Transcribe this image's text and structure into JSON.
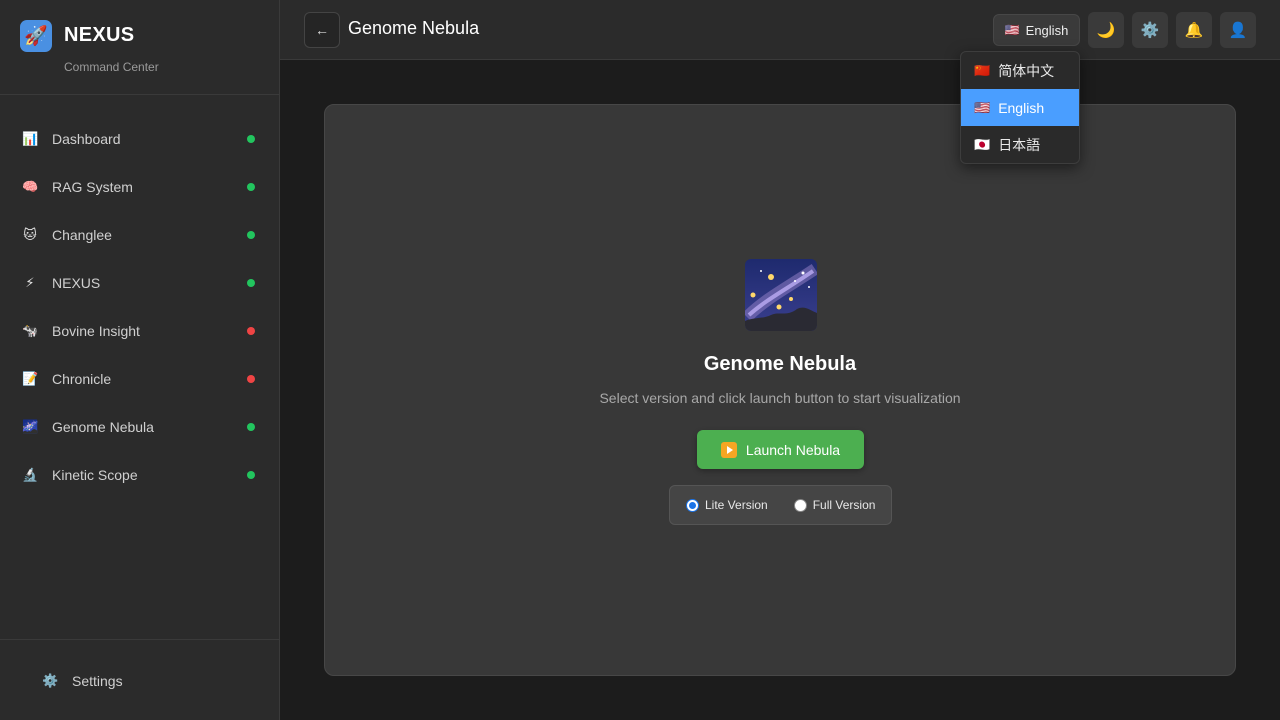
{
  "brand": {
    "name": "NEXUS",
    "subtitle": "Command Center",
    "logo_icon": "rocket-icon"
  },
  "sidebar": {
    "items": [
      {
        "label": "Dashboard",
        "icon": "bar-chart-icon",
        "glyph": "📊",
        "status": "online",
        "status_color": "#22c55e"
      },
      {
        "label": "RAG System",
        "icon": "brain-icon",
        "glyph": "🧠",
        "status": "online",
        "status_color": "#22c55e"
      },
      {
        "label": "Changlee",
        "icon": "cat-icon",
        "glyph": "🐱",
        "status": "online",
        "status_color": "#22c55e"
      },
      {
        "label": "NEXUS",
        "icon": "lightning-icon",
        "glyph": "⚡",
        "status": "online",
        "status_color": "#22c55e"
      },
      {
        "label": "Bovine Insight",
        "icon": "cow-icon",
        "glyph": "🐄",
        "status": "offline",
        "status_color": "#ef4444"
      },
      {
        "label": "Chronicle",
        "icon": "memo-icon",
        "glyph": "📝",
        "status": "offline",
        "status_color": "#ef4444"
      },
      {
        "label": "Genome Nebula",
        "icon": "milky-way-icon",
        "glyph": "🌌",
        "status": "online",
        "status_color": "#22c55e"
      },
      {
        "label": "Kinetic Scope",
        "icon": "microscope-icon",
        "glyph": "🔬",
        "status": "online",
        "status_color": "#22c55e"
      }
    ],
    "footer": {
      "label": "Settings",
      "icon": "gear-icon",
      "glyph": "⚙️"
    }
  },
  "header": {
    "title": "Genome Nebula",
    "back_glyph": "←",
    "language": {
      "current": "English",
      "flag": "🇺🇸"
    },
    "buttons": [
      {
        "name": "theme-toggle",
        "icon": "moon-icon",
        "glyph": "🌙"
      },
      {
        "name": "settings",
        "icon": "gear-icon",
        "glyph": "⚙️"
      },
      {
        "name": "notifications",
        "icon": "bell-icon",
        "glyph": "🔔"
      },
      {
        "name": "profile",
        "icon": "user-icon",
        "glyph": "👤"
      }
    ]
  },
  "language_menu": {
    "options": [
      {
        "label": "简体中文",
        "flag": "🇨🇳",
        "selected": false
      },
      {
        "label": "English",
        "flag": "🇺🇸",
        "selected": true
      },
      {
        "label": "日本語",
        "flag": "🇯🇵",
        "selected": false
      }
    ]
  },
  "main": {
    "title": "Genome Nebula",
    "subtitle": "Select version and click launch button to start visualization",
    "launch_label": "Launch Nebula",
    "versions": [
      {
        "label": "Lite Version",
        "selected": true
      },
      {
        "label": "Full Version",
        "selected": false
      }
    ]
  },
  "colors": {
    "accent": "#4a9eff",
    "launch": "#4caf50",
    "online": "#22c55e",
    "offline": "#ef4444"
  }
}
